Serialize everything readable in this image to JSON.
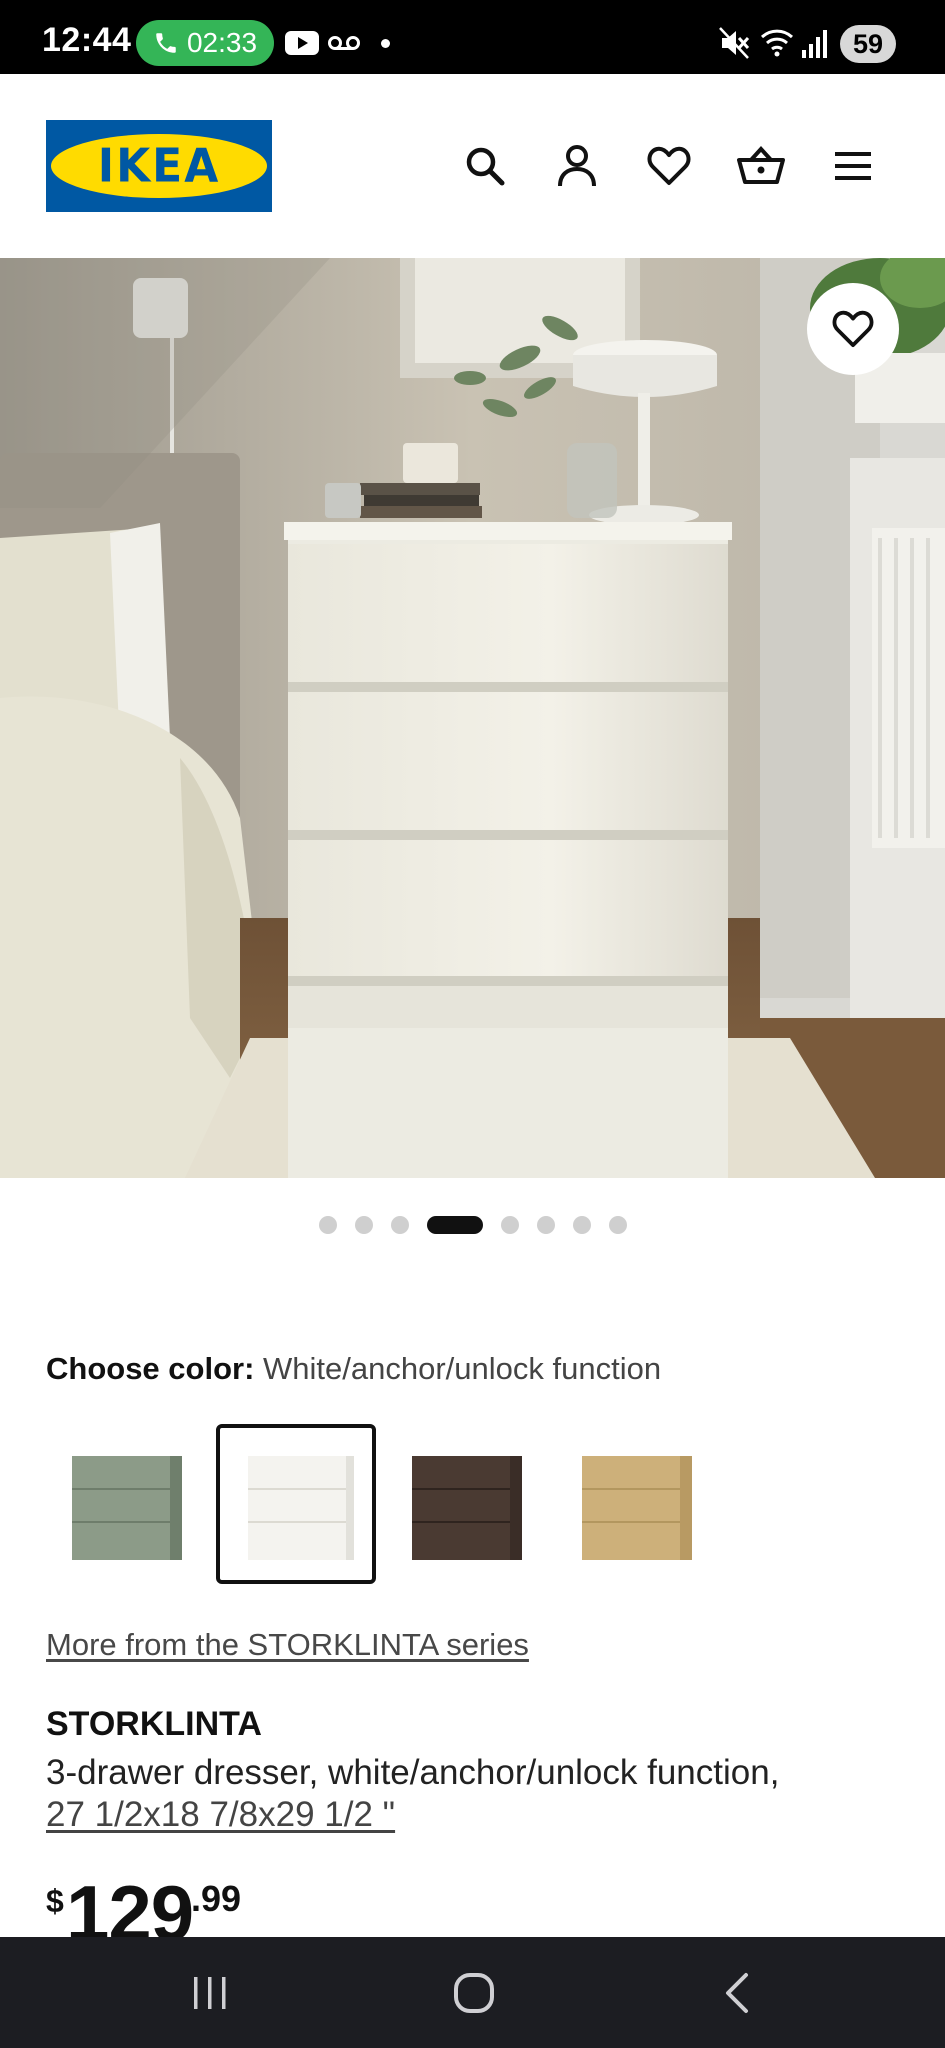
{
  "status_bar": {
    "time": "12:44",
    "call_timer": "02:33",
    "battery": "59",
    "icons": [
      "phone-icon",
      "youtube-icon",
      "voicemail-icon",
      "mute-icon",
      "wifi-icon",
      "signal-icon",
      "battery-icon"
    ]
  },
  "header": {
    "logo_text": "IKEA",
    "logo_colors": {
      "blue": "#0058a3",
      "yellow": "#ffdb00"
    },
    "icons": [
      "search-icon",
      "account-icon",
      "favorites-icon",
      "cart-icon",
      "menu-icon"
    ]
  },
  "gallery": {
    "dot_count": 8,
    "active_index": 3
  },
  "color_chooser": {
    "label": "Choose color:",
    "value": "White/anchor/unlock function",
    "swatches": [
      {
        "name": "gray-green",
        "color": "#7f8f7c",
        "selected": false
      },
      {
        "name": "white",
        "color": "#f4f3ef",
        "selected": true
      },
      {
        "name": "dark-brown",
        "color": "#4a3a32",
        "selected": false
      },
      {
        "name": "oak",
        "color": "#cdb07a",
        "selected": false
      }
    ]
  },
  "product": {
    "series_link": "More from the STORKLINTA series",
    "name": "STORKLINTA",
    "description": "3-drawer dresser, white/anchor/unlock function,",
    "size": "27 1/2x18 7/8x29 1/2 \"",
    "price_currency": "$",
    "price_integer": "129",
    "price_decimal": ".99"
  },
  "nav_bar": {
    "icons": [
      "recents-icon",
      "home-icon",
      "back-icon"
    ]
  }
}
